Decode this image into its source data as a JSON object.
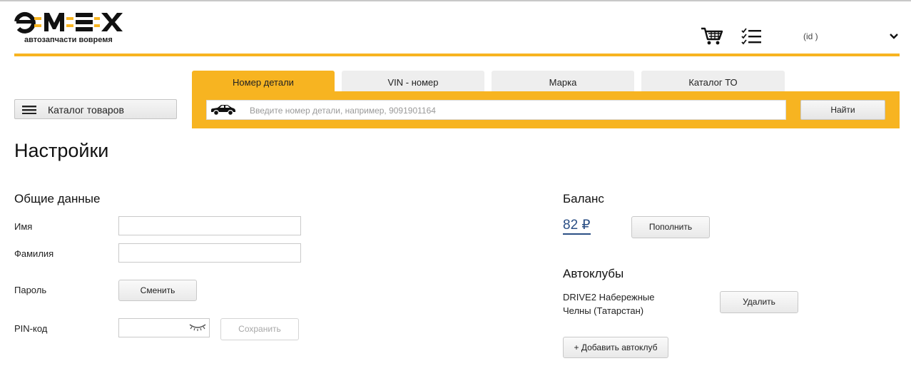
{
  "header": {
    "logo_text": "e-MEX",
    "logo_tagline": "автозапчасти вовремя",
    "cart_icon": "shopping-cart-icon",
    "orders_icon": "checklist-icon",
    "user_id_text": "(id          )",
    "chevron_icon": "chevron-down-icon",
    "accent_color": "#f7b421"
  },
  "catalog": {
    "label": "Каталог товаров",
    "icon": "hamburger-icon"
  },
  "search": {
    "tabs": [
      {
        "label": "Номер детали",
        "active": true
      },
      {
        "label": "VIN - номер",
        "active": false
      },
      {
        "label": "Марка",
        "active": false
      },
      {
        "label": "Каталог ТО",
        "active": false
      }
    ],
    "placeholder": "Введите номер детали, например, 9091901164",
    "value": "",
    "button_label": "Найти",
    "car_icon": "car-icon"
  },
  "page": {
    "title": "Настройки"
  },
  "general": {
    "title": "Общие данные",
    "first_name_label": "Имя",
    "first_name_value": "",
    "last_name_label": "Фамилия",
    "last_name_value": "",
    "password_label": "Пароль",
    "change_button": "Сменить",
    "pin_label": "PIN-код",
    "pin_value": "",
    "eye_icon": "eye-closed-icon",
    "save_button": "Сохранить"
  },
  "balance": {
    "title": "Баланс",
    "amount": "82 ₽",
    "topup_button": "Пополнить",
    "link_color": "#2b4f85"
  },
  "autoclubs": {
    "title": "Автоклубы",
    "items": [
      {
        "name": "DRIVE2 Набережные Челны (Татарстан)",
        "delete_button": "Удалить"
      }
    ],
    "add_button": "+ Добавить автоклуб"
  }
}
